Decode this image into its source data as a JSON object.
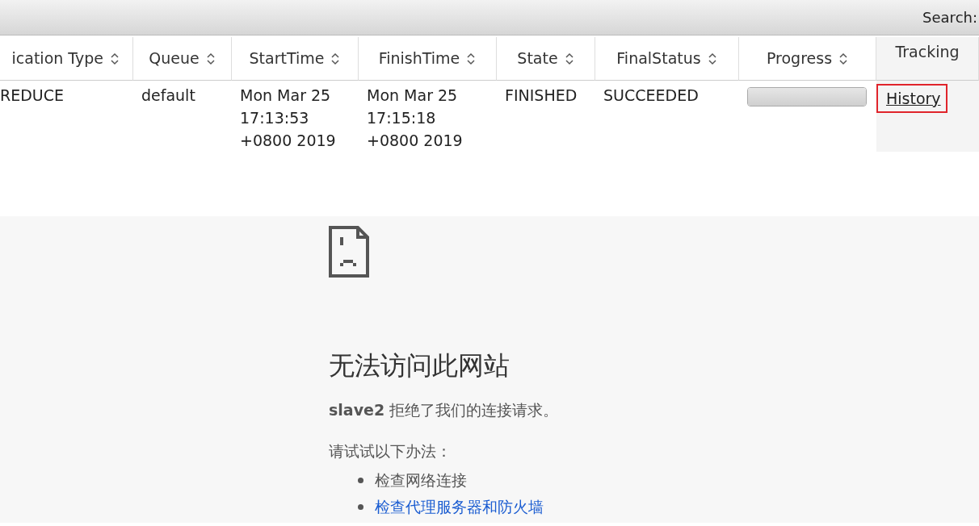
{
  "toolbar": {
    "search_label": "Search:"
  },
  "table": {
    "columns": [
      {
        "label": "ication Type",
        "sortable": true
      },
      {
        "label": "Queue",
        "sortable": true
      },
      {
        "label": "StartTime",
        "sortable": true
      },
      {
        "label": "FinishTime",
        "sortable": true
      },
      {
        "label": "State",
        "sortable": true
      },
      {
        "label": "FinalStatus",
        "sortable": true
      },
      {
        "label": "Progress",
        "sortable": true
      },
      {
        "label": "Tracking",
        "sortable": false
      }
    ],
    "rows": [
      {
        "application_type": "REDUCE",
        "queue": "default",
        "start_time": [
          "Mon Mar 25",
          "17:13:53",
          "+0800 2019"
        ],
        "finish_time": [
          "Mon Mar 25",
          "17:15:18",
          "+0800 2019"
        ],
        "state": "FINISHED",
        "final_status": "SUCCEEDED",
        "progress": {
          "level": 1
        },
        "tracking": {
          "label": "History",
          "highlighted": true
        }
      }
    ]
  },
  "error_page": {
    "title": "无法访问此网站",
    "host": "slave2",
    "message": "拒绝了我们的连接请求。",
    "suggestion_intro": "请试试以下办法：",
    "suggestions": [
      {
        "text": "检查网络连接",
        "link": false
      },
      {
        "text": "检查代理服务器和防火墙",
        "link": true
      }
    ]
  }
}
